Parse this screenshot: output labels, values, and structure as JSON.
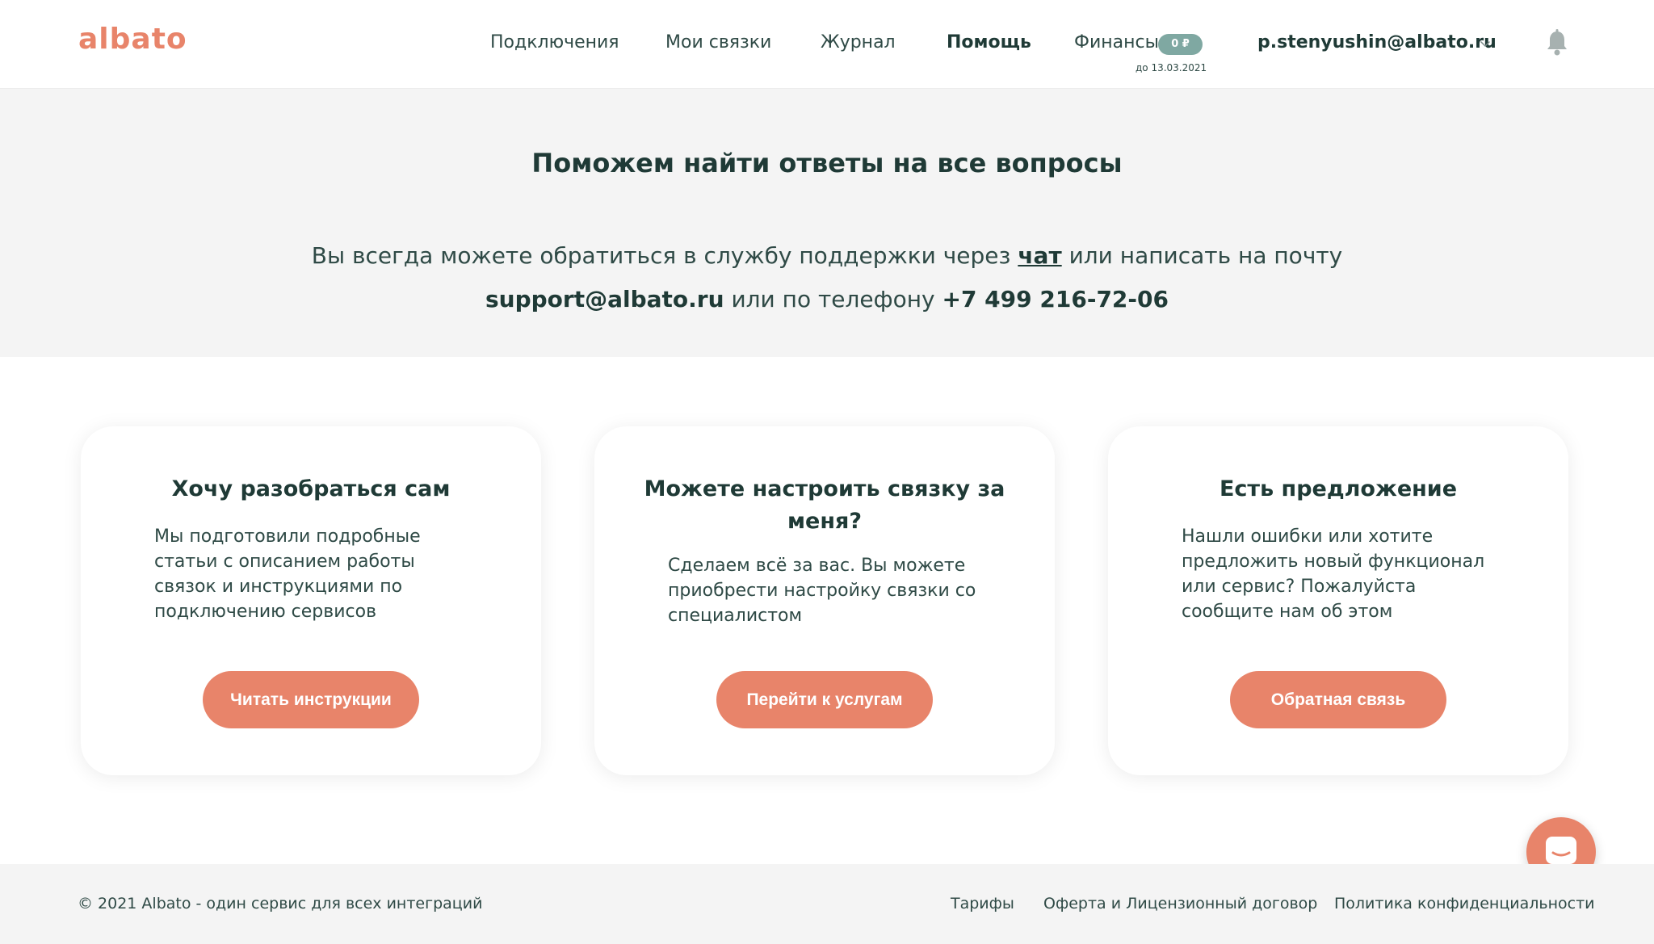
{
  "header": {
    "logo": "albato",
    "nav": {
      "connections": "Подключения",
      "my_bundles": "Мои связки",
      "journal": "Журнал",
      "help": "Помощь",
      "finance": "Финансы"
    },
    "finance_badge": "0 ₽",
    "finance_date": "до 13.03.2021",
    "user_email": "p.stenyushin@albato.ru"
  },
  "hero": {
    "title": "Поможем найти ответы на все вопросы",
    "line1_before": "Вы всегда можете обратиться в службу поддержки через ",
    "chat_link": "чат",
    "line1_after": " или написать на почту",
    "email": "support@albato.ru",
    "line2_middle": " или по телефону ",
    "phone": "+7 499 216-72-06"
  },
  "cards": [
    {
      "title": "Хочу разобраться сам",
      "text": "Мы подготовили подробные статьи с описанием работы связок и инструкциями по подключению сервисов",
      "button": "Читать инструкции"
    },
    {
      "title": "Можете настроить связку за меня?",
      "text": "Сделаем всё за вас. Вы можете приобрести настройку связки со специалистом",
      "button": "Перейти к услугам"
    },
    {
      "title": "Есть предложение",
      "text": "Нашли ошибки или хотите предложить новый функционал или сервис? Пожалуйста сообщите нам об этом",
      "button": "Обратная связь"
    }
  ],
  "footer": {
    "copyright": "© 2021 Albato - один сервис для всех интеграций",
    "links": {
      "tariffs": "Тарифы",
      "offer": "Оферта и Лицензионный договор",
      "privacy": "Политика конфиденциальности"
    }
  },
  "icons": {
    "chevron": "chevron-down-icon",
    "bell": "bell-icon",
    "chat": "chat-icon"
  },
  "colors": {
    "brand": "#e8846a",
    "text": "#1f3a36",
    "badge": "#7fa8a2",
    "surface": "#f4f4f4"
  }
}
